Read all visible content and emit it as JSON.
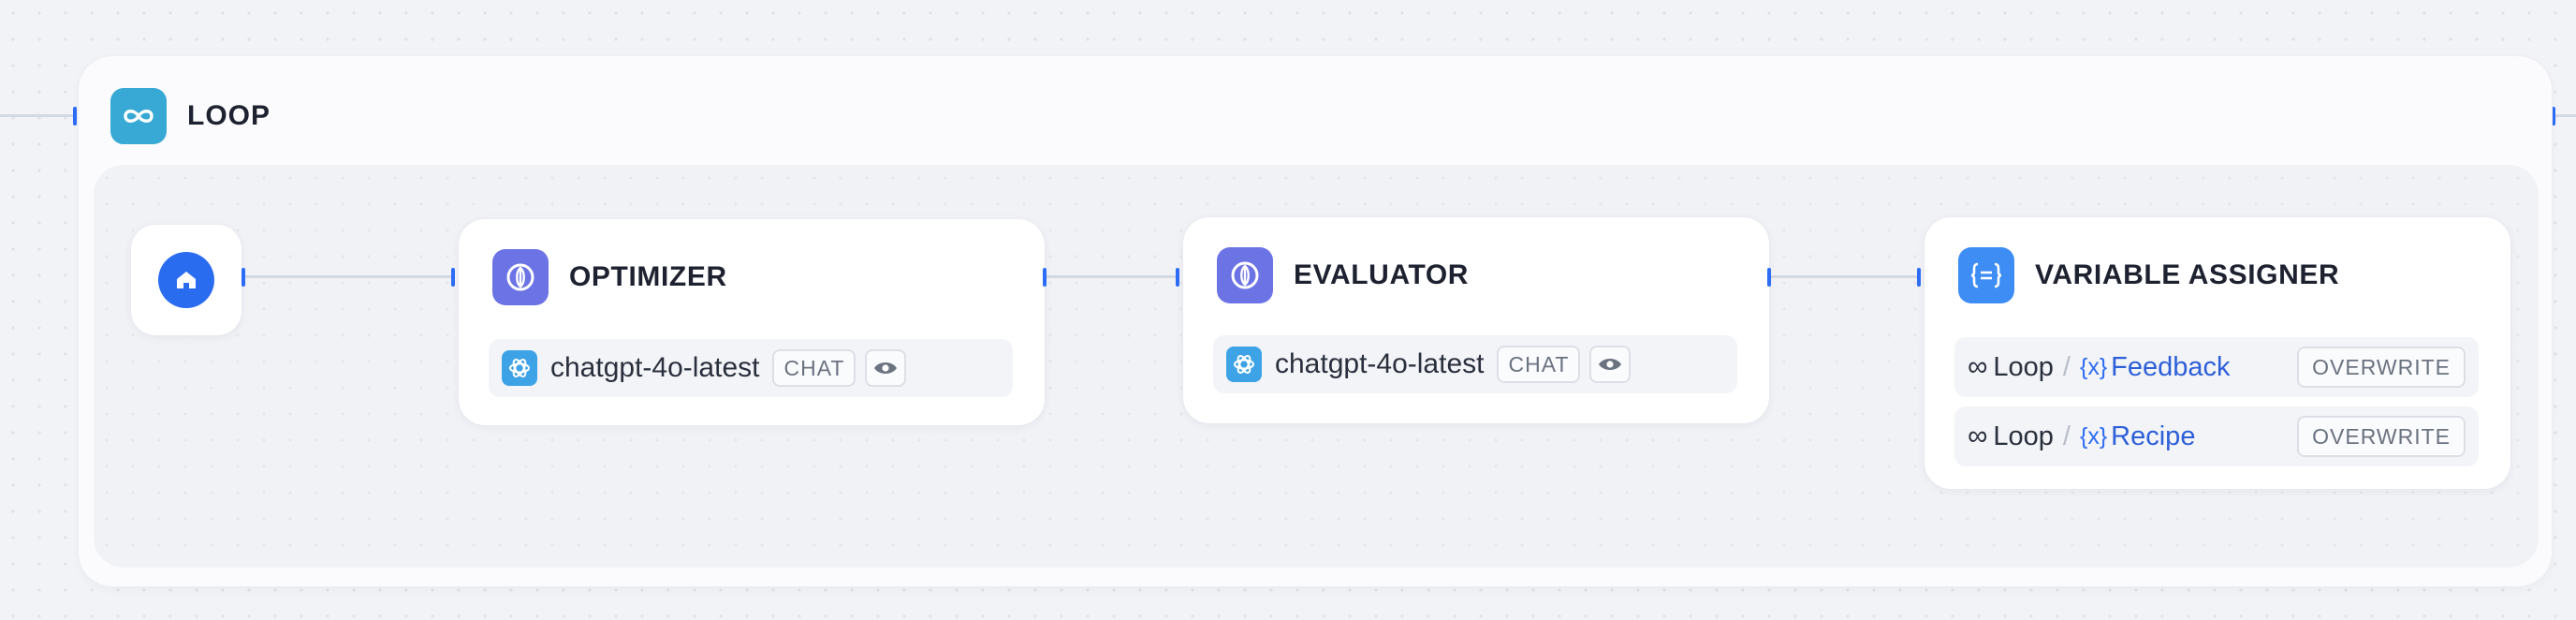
{
  "loop": {
    "title": "LOOP",
    "icon": "infinity-icon"
  },
  "start": {
    "icon": "home-icon"
  },
  "optimizer": {
    "title": "OPTIMIZER",
    "icon": "llm-icon",
    "model": "chatgpt-4o-latest",
    "mode": "CHAT",
    "model_icon": "openai-icon"
  },
  "evaluator": {
    "title": "EVALUATOR",
    "icon": "llm-icon",
    "model": "chatgpt-4o-latest",
    "mode": "CHAT",
    "model_icon": "openai-icon"
  },
  "assigner": {
    "title": "VARIABLE ASSIGNER",
    "icon": "variable-assigner-icon",
    "rows": [
      {
        "source": "Loop",
        "variable": "Feedback",
        "operation": "OVERWRITE",
        "var_prefix": "{x}"
      },
      {
        "source": "Loop",
        "variable": "Recipe",
        "operation": "OVERWRITE",
        "var_prefix": "{x}"
      }
    ]
  },
  "colors": {
    "accent": "#2d6cf6",
    "llm": "#6c73e4",
    "loop": "#37a9d4",
    "assigner": "#3d8df5"
  }
}
